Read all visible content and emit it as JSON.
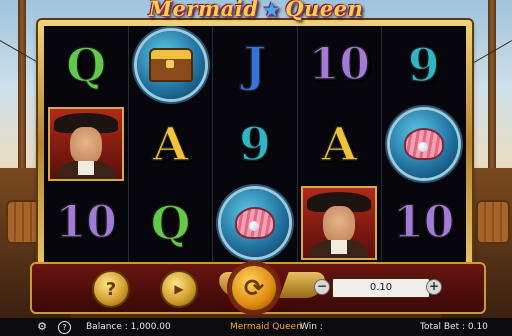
{
  "title": {
    "part1": "Mermaid",
    "part2": "Queen"
  },
  "reels": [
    [
      "Q",
      "chest",
      "J",
      "10",
      "9"
    ],
    [
      "pirate",
      "A",
      "9",
      "A",
      "shell"
    ],
    [
      "10",
      "Q",
      "shell",
      "pirate",
      "10"
    ]
  ],
  "controls": {
    "help_icon": "?",
    "autoplay_icon": "autoplay",
    "spin_icon": "spin",
    "minus": "−",
    "plus": "+",
    "bet_value": "0.10"
  },
  "status": {
    "balance_label": "Balance : 1,000.00",
    "game_name": "Mermaid Queen",
    "win_label": "Win :",
    "total_bet_label": "Total Bet : 0.10"
  },
  "colors": {
    "accent_gold": "#d09a28",
    "bar_red": "#6a1410",
    "game_name": "#f0a830"
  }
}
